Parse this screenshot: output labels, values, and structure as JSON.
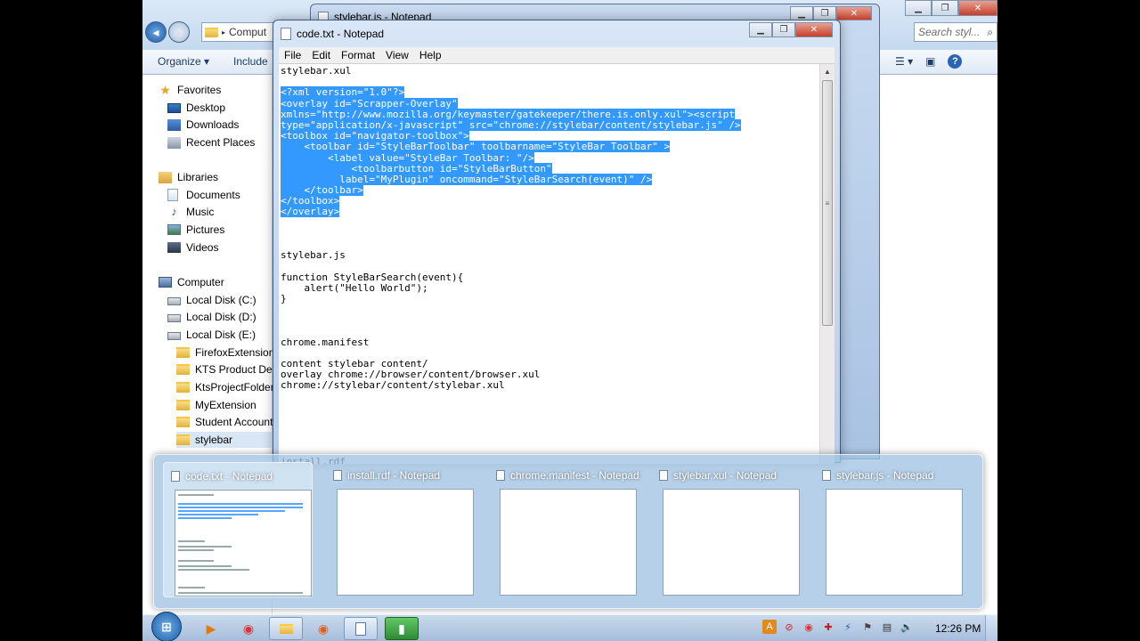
{
  "explorer": {
    "address_text": "Comput",
    "search_placeholder": "Search styl...",
    "toolbar": {
      "organize": "Organize ▾",
      "include": "Include"
    },
    "nav": {
      "favorites": "Favorites",
      "desktop": "Desktop",
      "downloads": "Downloads",
      "recent": "Recent Places",
      "libraries": "Libraries",
      "documents": "Documents",
      "music": "Music",
      "pictures": "Pictures",
      "videos": "Videos",
      "computer": "Computer",
      "disk_c": "Local Disk (C:)",
      "disk_d": "Local Disk (D:)",
      "disk_e": "Local Disk (E:)",
      "folders": [
        "FirefoxExtension",
        "KTS Product Dem",
        "KtsProjectFolder",
        "MyExtension",
        "Student Accounts",
        "stylebar"
      ]
    }
  },
  "notepad_back": {
    "title": "stylebar.js - Notepad"
  },
  "notepad": {
    "title": "code.txt - Notepad",
    "menus": [
      "File",
      "Edit",
      "Format",
      "View",
      "Help"
    ],
    "lines": [
      {
        "text": "stylebar.xul",
        "sel": false
      },
      {
        "text": "",
        "sel": false
      },
      {
        "text": "<?xml version=\"1.0\"?>",
        "sel": true
      },
      {
        "text": "<overlay id=\"Scrapper-Overlay\"",
        "sel": true
      },
      {
        "text": "xmlns=\"http://www.mozilla.org/keymaster/gatekeeper/there.is.only.xul\"><script",
        "sel": true
      },
      {
        "text": "type=\"application/x-javascript\" src=\"chrome://stylebar/content/stylebar.js\" />",
        "sel": true
      },
      {
        "text": "<toolbox id=\"navigator-toolbox\">",
        "sel": true
      },
      {
        "text": "    <toolbar id=\"StyleBarToolbar\" toolbarname=\"StyleBar Toolbar\" >",
        "sel": true
      },
      {
        "text": "        <label value=\"StyleBar Toolbar: \"/>",
        "sel": true
      },
      {
        "text": "            <toolbarbutton id=\"StyleBarButton\"",
        "sel": true
      },
      {
        "text": "          label=\"MyPlugin\" oncommand=\"StyleBarSearch(event)\" />",
        "sel": true
      },
      {
        "text": "    </toolbar>",
        "sel": true
      },
      {
        "text": "</toolbox>",
        "sel": true
      },
      {
        "text": "</overlay>",
        "sel": true
      },
      {
        "text": "",
        "sel": false
      },
      {
        "text": "",
        "sel": false
      },
      {
        "text": "",
        "sel": false
      },
      {
        "text": "stylebar.js",
        "sel": false
      },
      {
        "text": "",
        "sel": false
      },
      {
        "text": "function StyleBarSearch(event){",
        "sel": false
      },
      {
        "text": "    alert(\"Hello World\");",
        "sel": false
      },
      {
        "text": "}",
        "sel": false
      },
      {
        "text": "",
        "sel": false
      },
      {
        "text": "",
        "sel": false
      },
      {
        "text": "",
        "sel": false
      },
      {
        "text": "chrome.manifest",
        "sel": false
      },
      {
        "text": "",
        "sel": false
      },
      {
        "text": "content stylebar content/",
        "sel": false
      },
      {
        "text": "overlay chrome://browser/content/browser.xul",
        "sel": false
      },
      {
        "text": "chrome://stylebar/content/stylebar.xul",
        "sel": false
      },
      {
        "text": "",
        "sel": false
      },
      {
        "text": "",
        "sel": false
      },
      {
        "text": "",
        "sel": false
      },
      {
        "text": "",
        "sel": false
      },
      {
        "text": "",
        "sel": false
      },
      {
        "text": "",
        "sel": false
      },
      {
        "text": "install.rdf",
        "sel": false
      }
    ]
  },
  "peek": {
    "thumbnails": [
      {
        "title": "code.txt - Notepad",
        "active": true
      },
      {
        "title": "install.rdf - Notepad",
        "active": false
      },
      {
        "title": "chrome.manifest - Notepad",
        "active": false
      },
      {
        "title": "stylebar.xul - Notepad",
        "active": false
      },
      {
        "title": "stylebar.js - Notepad",
        "active": false
      }
    ]
  },
  "taskbar": {
    "clock": "12:26 PM",
    "apps": [
      "media-player-icon",
      "chrome-icon",
      "explorer-icon",
      "firefox-icon",
      "notepad-icon",
      "green-app-icon"
    ]
  }
}
